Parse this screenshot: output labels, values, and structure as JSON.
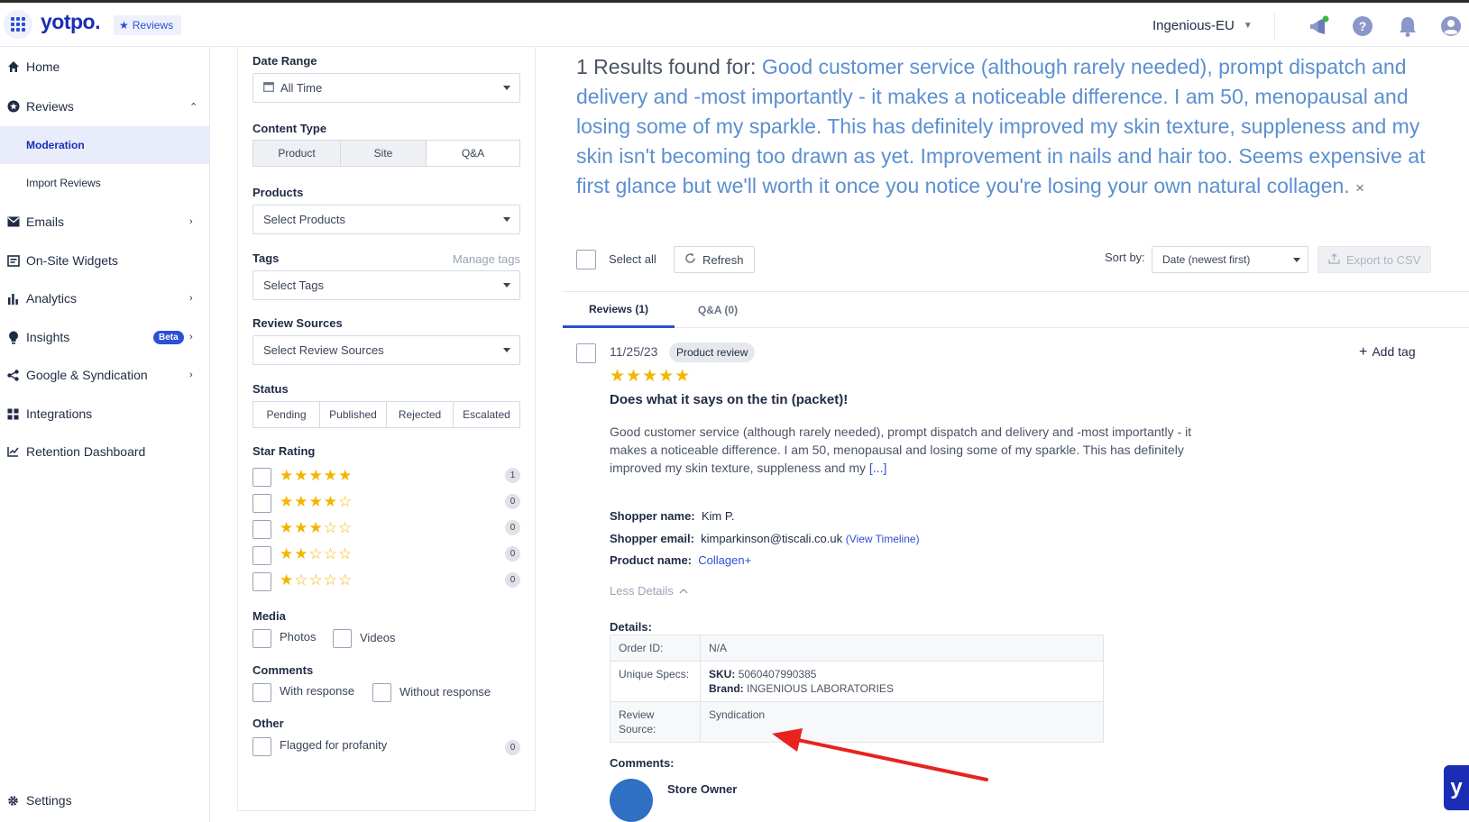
{
  "topbar": {
    "logo": "yotpo.",
    "product": "Reviews",
    "store": "Ingenious-EU"
  },
  "sidebar": {
    "items": [
      {
        "label": "Home",
        "icon": "home-icon"
      },
      {
        "label": "Reviews",
        "icon": "star-badge-icon"
      },
      {
        "label": "Moderation"
      },
      {
        "label": "Import Reviews"
      },
      {
        "label": "Emails",
        "icon": "mail-icon"
      },
      {
        "label": "On-Site Widgets",
        "icon": "widget-icon"
      },
      {
        "label": "Analytics",
        "icon": "bar-chart-icon"
      },
      {
        "label": "Insights",
        "icon": "bulb-icon",
        "badge": "Beta"
      },
      {
        "label": "Google & Syndication",
        "icon": "share-icon"
      },
      {
        "label": "Integrations",
        "icon": "integrations-icon"
      },
      {
        "label": "Retention Dashboard",
        "icon": "line-chart-icon"
      },
      {
        "label": "Settings",
        "icon": "gear-icon"
      }
    ]
  },
  "filters": {
    "date_range": {
      "title": "Date Range",
      "value": "All Time"
    },
    "content_type": {
      "title": "Content Type",
      "options": [
        "Product",
        "Site",
        "Q&A"
      ]
    },
    "products": {
      "title": "Products",
      "placeholder": "Select Products"
    },
    "tags": {
      "title": "Tags",
      "manage": "Manage tags",
      "placeholder": "Select Tags"
    },
    "review_sources": {
      "title": "Review Sources",
      "placeholder": "Select Review Sources"
    },
    "status": {
      "title": "Status",
      "options": [
        "Pending",
        "Published",
        "Rejected",
        "Escalated"
      ]
    },
    "star_rating": {
      "title": "Star Rating",
      "rows": [
        {
          "stars": "★★★★★",
          "count": "1"
        },
        {
          "stars": "★★★★☆",
          "count": "0"
        },
        {
          "stars": "★★★☆☆",
          "count": "0"
        },
        {
          "stars": "★★☆☆☆",
          "count": "0"
        },
        {
          "stars": "★☆☆☆☆",
          "count": "0"
        }
      ]
    },
    "media": {
      "title": "Media",
      "photos": "Photos",
      "videos": "Videos"
    },
    "comments": {
      "title": "Comments",
      "with": "With response",
      "without": "Without response"
    },
    "other": {
      "title": "Other",
      "flagged": "Flagged for profanity",
      "count": "0"
    }
  },
  "main": {
    "results_prefix": "1 Results found for: ",
    "query": "Good customer service (although rarely needed), prompt dispatch and delivery and -most importantly - it makes a noticeable difference. I am 50, menopausal and losing some of my sparkle. This has definitely improved my skin texture, suppleness and my skin isn't becoming too drawn as yet. Improvement in nails and hair too. Seems expensive at first glance but we'll worth it once you notice you're losing your own natural collagen.",
    "clear": "×",
    "select_all": "Select all",
    "refresh": "Refresh",
    "sort_label": "Sort by:",
    "sort_value": "Date (newest first)",
    "export": "Export to CSV",
    "tabs": [
      "Reviews (1)",
      "Q&A (0)"
    ]
  },
  "review": {
    "date": "11/25/23",
    "type": "Product review",
    "add_tag": "Add tag",
    "stars": "★★★★★",
    "rating": 5,
    "title": "Does what it says on the tin (packet)!",
    "body": "Good customer service (although rarely needed), prompt dispatch and delivery and -most importantly - it makes a noticeable difference. I am 50, menopausal and losing some of my sparkle. This has definitely improved my skin texture, suppleness and my",
    "more": "[...]",
    "shopper_name_label": "Shopper name:",
    "shopper_name": "Kim P.",
    "shopper_email_label": "Shopper email:",
    "shopper_email": "kimparkinson@tiscali.co.uk",
    "view_timeline": "(View Timeline)",
    "product_name_label": "Product name:",
    "product_name": "Collagen+",
    "less_details": "Less Details",
    "details_title": "Details:",
    "details": {
      "order_id_label": "Order ID:",
      "order_id": "N/A",
      "specs_label": "Unique Specs:",
      "sku_label": "SKU:",
      "sku": "5060407990385",
      "brand_label": "Brand:",
      "brand": "INGENIOUS LABORATORIES",
      "source_label": "Review Source:",
      "source": "Syndication"
    },
    "comments_title": "Comments:",
    "commenter": "Store Owner"
  },
  "colors": {
    "brand": "#1b2db5",
    "accent": "#2d4fd6",
    "star": "#f5b400",
    "annotation_arrow": "#e8231f"
  }
}
